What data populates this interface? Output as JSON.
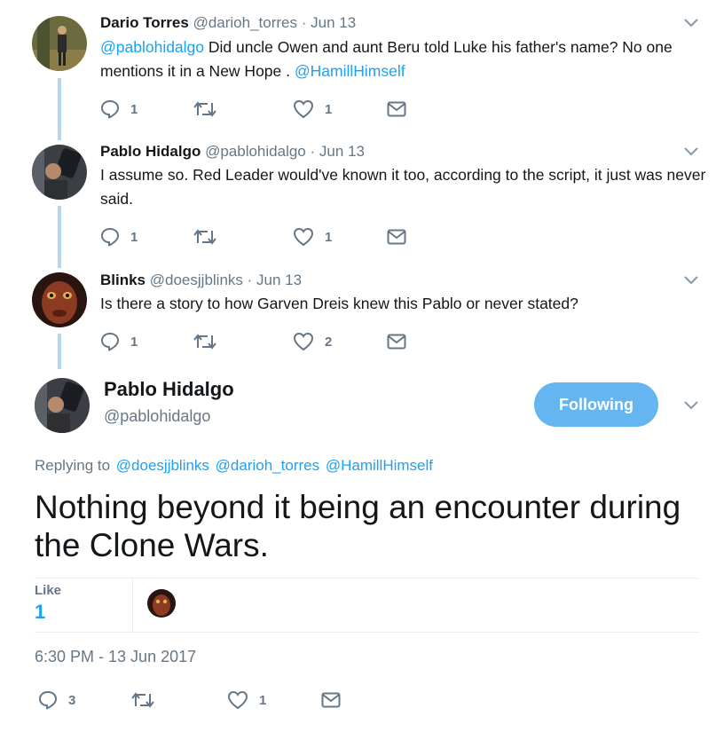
{
  "replies": [
    {
      "name": "Dario Torres",
      "handle": "@darioh_torres",
      "sep": "·",
      "date": "Jun 13",
      "mention_lead": "@pablohidalgo",
      "text": " Did uncle Owen and aunt Beru told Luke his father's name? No one mentions it in a New Hope . ",
      "mention_tail": "@HamillHimself",
      "reply_count": "1",
      "like_count": "1",
      "avatar_icon": "person-standing-avatar"
    },
    {
      "name": "Pablo Hidalgo",
      "handle": "@pablohidalgo",
      "sep": "·",
      "date": "Jun 13",
      "text": "I assume so. Red Leader would've known it too, according to the script, it just was never said.",
      "reply_count": "1",
      "like_count": "1",
      "avatar_icon": "person-with-camera-avatar"
    },
    {
      "name": "Blinks",
      "handle": "@doesjjblinks",
      "sep": "·",
      "date": "Jun 13",
      "text": "Is there a story to how Garven Dreis knew this Pablo or never stated?",
      "reply_count": "1",
      "like_count": "2",
      "avatar_icon": "alien-face-avatar"
    }
  ],
  "main": {
    "name": "Pablo Hidalgo",
    "handle": "@pablohidalgo",
    "follow_label": "Following",
    "replying_label": "Replying to",
    "replying_to": [
      "@doesjjblinks",
      "@darioh_torres",
      "@HamillHimself"
    ],
    "text": "Nothing beyond it being an encounter during the Clone Wars.",
    "like_label": "Like",
    "like_count": "1",
    "timestamp": "6:30 PM - 13 Jun 2017",
    "reply_count": "3",
    "retweet_count": "",
    "fav_count": "1"
  },
  "colors": {
    "accent": "#1da1f2",
    "follow_button": "#64b5f0",
    "muted": "#657786",
    "thread_line": "#b2d7f3"
  }
}
